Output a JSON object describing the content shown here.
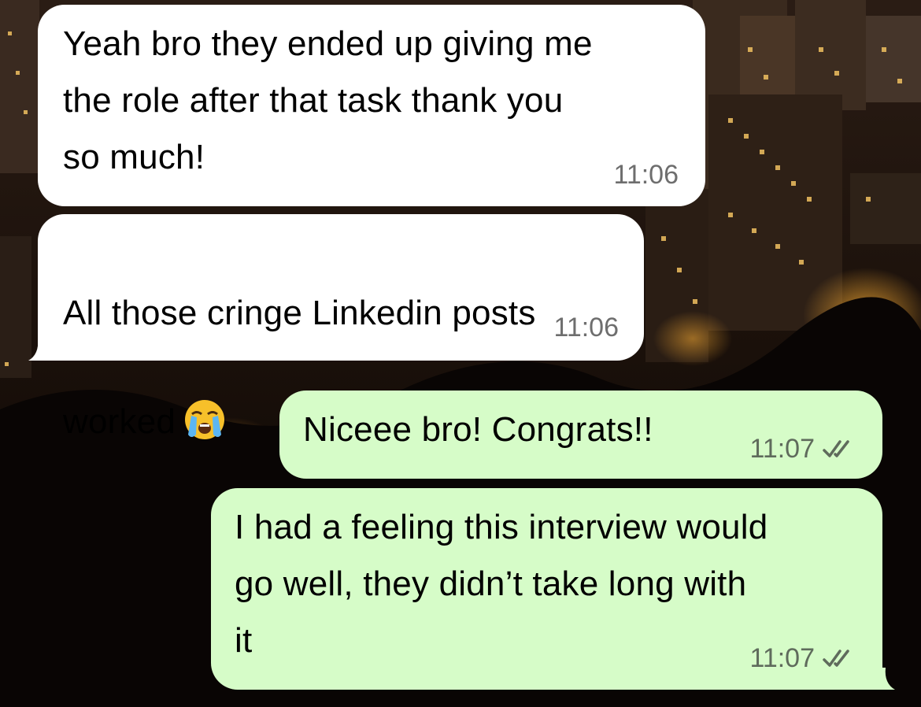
{
  "chat": {
    "messages": [
      {
        "direction": "incoming",
        "text": "Yeah bro they ended up giving me\nthe role after that task thank you\nso much!",
        "time": "11:06"
      },
      {
        "direction": "incoming",
        "text": "All those cringe Linkedin posts\nworked",
        "emoji": "loudly-crying-face",
        "time": "11:06"
      },
      {
        "direction": "outgoing",
        "text": "Niceee bro! Congrats!!",
        "time": "11:07",
        "status": "read",
        "status_icon": "double-check-icon"
      },
      {
        "direction": "outgoing",
        "text": "I had a feeling this interview would\ngo well, they didn’t take long with\nit",
        "time": "11:07",
        "status": "read",
        "status_icon": "double-check-icon"
      }
    ]
  },
  "colors": {
    "incoming_bubble": "#ffffff",
    "outgoing_bubble": "#d6fcc8",
    "timestamp": "#6e6e6e",
    "wallpaper": "#0d0704"
  }
}
